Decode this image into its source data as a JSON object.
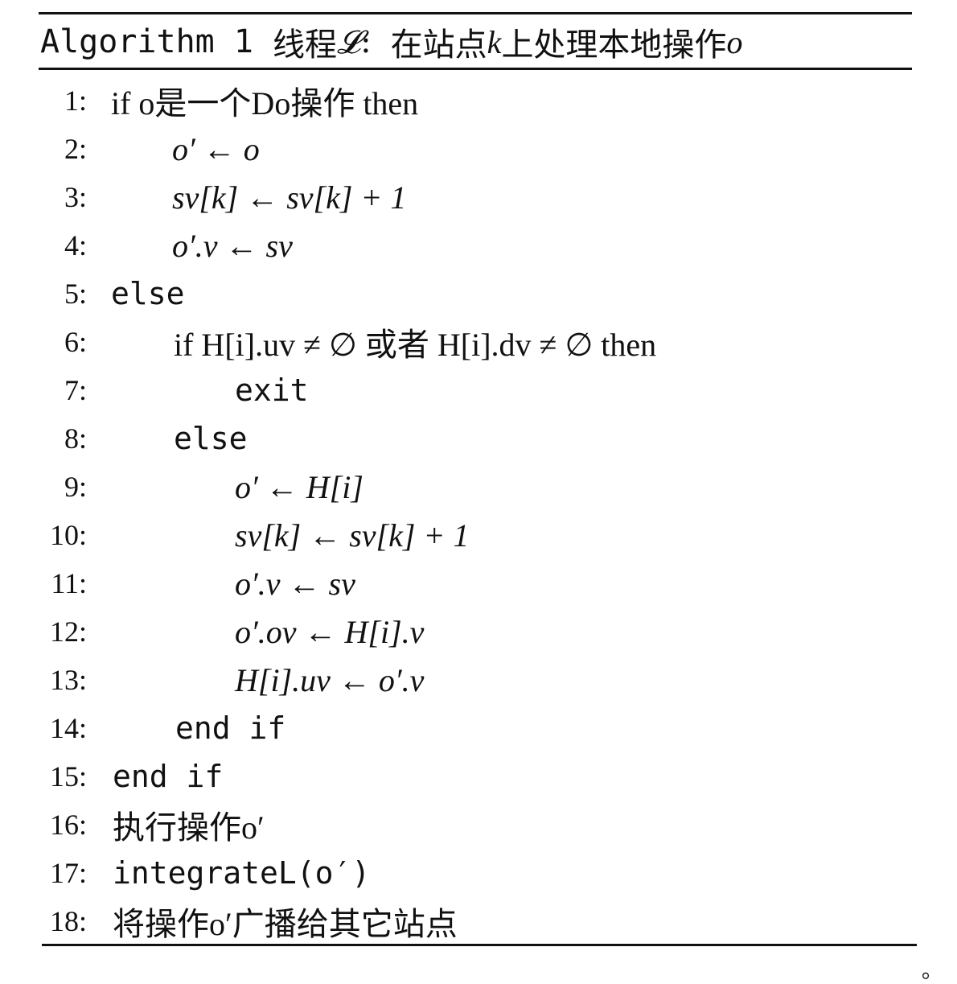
{
  "algorithm": {
    "caption_prefix": "Algorithm 1",
    "caption_thread": "线程",
    "caption_symbol": "𝓛",
    "caption_colon": ":",
    "caption_text_1": "在站点",
    "caption_k": "k",
    "caption_text_2": "上处理本地操作",
    "caption_o": "o",
    "lines": [
      {
        "num": "1:",
        "text": "if o是一个Do操作 then"
      },
      {
        "num": "2:",
        "text": "o′ ← o"
      },
      {
        "num": "3:",
        "text": "sv[k] ← sv[k] + 1"
      },
      {
        "num": "4:",
        "text": "o′.v ← sv"
      },
      {
        "num": "5:",
        "text": "else"
      },
      {
        "num": "6:",
        "text": "if H[i].uv ≠ ∅ 或者 H[i].dv ≠ ∅ then"
      },
      {
        "num": "7:",
        "text": "exit"
      },
      {
        "num": "8:",
        "text": "else"
      },
      {
        "num": "9:",
        "text": "o′ ← H[i]"
      },
      {
        "num": "10:",
        "text": "sv[k] ← sv[k] + 1"
      },
      {
        "num": "11:",
        "text": "o′.v ← sv"
      },
      {
        "num": "12:",
        "text": "o′.ov ← H[i].v"
      },
      {
        "num": "13:",
        "text": "H[i].uv ← o′.v"
      },
      {
        "num": "14:",
        "text": "end if"
      },
      {
        "num": "15:",
        "text": "end if"
      },
      {
        "num": "16:",
        "text": "执行操作o′"
      },
      {
        "num": "17:",
        "text": "integrateL(o′)"
      },
      {
        "num": "18:",
        "text": "将操作o′广播给其它站点"
      }
    ],
    "trailing_mark": "。"
  }
}
